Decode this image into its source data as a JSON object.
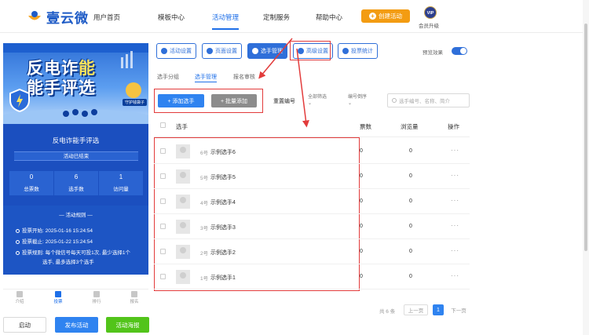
{
  "brand": {
    "name": "壹云微"
  },
  "nav": {
    "items": [
      "用户首页",
      "模板中心",
      "活动管理",
      "定制服务",
      "帮助中心"
    ],
    "create_label": "创建活动",
    "vip_badge": "VIP",
    "vip_label": "会员升级"
  },
  "preview": {
    "banner_line1_a": "反电诈",
    "banner_line1_b": "能",
    "banner_line2": "能手评选",
    "ribbon": "守护钱袋子",
    "event_title": "反电诈能手评选",
    "status": "活动已结束",
    "stats": [
      {
        "value": "0",
        "label": "总票数"
      },
      {
        "value": "6",
        "label": "选手数"
      },
      {
        "value": "1",
        "label": "访问量"
      }
    ],
    "rules_heading": "— 活动规则 —",
    "rules": [
      "投票开始: 2025-01-16 15:24:54",
      "投票截止: 2025-01-22 15:24:54",
      "投票规则: 每个微信号每天可投1次, 最少选择1个",
      "选手, 最多选择3个选手"
    ],
    "tabs": [
      "介绍",
      "投票",
      "排行",
      "报名"
    ]
  },
  "footer_buttons": {
    "start": "启动",
    "publish": "发布活动",
    "poster": "活动海报"
  },
  "settings_tabs": [
    "活动设置",
    "页面设置",
    "选手管理",
    "高级设置",
    "投票统计"
  ],
  "preview_toggle_label": "预览效果",
  "sub_tabs": [
    "选手分组",
    "选手管理",
    "报名审核"
  ],
  "toolbar": {
    "add": "+ 添加选手",
    "batch_add": "+ 批量添加",
    "reset_number": "重置编号",
    "filter_all": "全部筛选",
    "sort_number": "编号倒序",
    "search_placeholder": "选手编号、名称、简介"
  },
  "table": {
    "headers": [
      "选手",
      "票数",
      "浏览量",
      "操作"
    ],
    "rows": [
      {
        "number": "6号",
        "name": "示例选手6",
        "votes": "0",
        "views": "0",
        "action": "···"
      },
      {
        "number": "5号",
        "name": "示例选手5",
        "votes": "0",
        "views": "0",
        "action": "···"
      },
      {
        "number": "4号",
        "name": "示例选手4",
        "votes": "0",
        "views": "0",
        "action": "···"
      },
      {
        "number": "3号",
        "name": "示例选手3",
        "votes": "0",
        "views": "0",
        "action": "···"
      },
      {
        "number": "2号",
        "name": "示例选手2",
        "votes": "0",
        "views": "0",
        "action": "···"
      },
      {
        "number": "1号",
        "name": "示例选手1",
        "votes": "0",
        "views": "0",
        "action": "···"
      }
    ]
  },
  "pagination": {
    "total": "共 6 条",
    "prev": "上一页",
    "current": "1",
    "next": "下一页"
  },
  "colors": {
    "primary": "#2f6fd9",
    "accent": "#f39c12",
    "annotation": "#e23b3b",
    "success": "#52c41a"
  }
}
